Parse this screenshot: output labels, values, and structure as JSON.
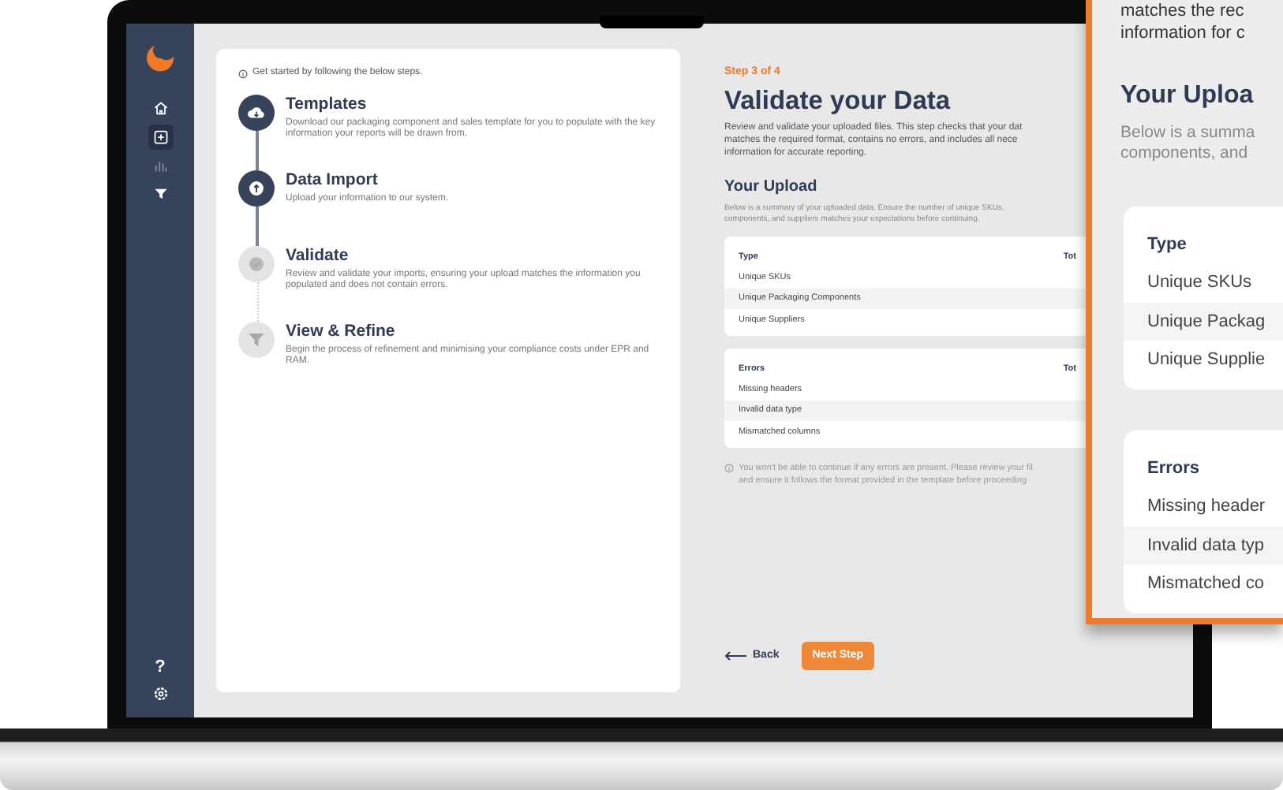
{
  "sidebar": {
    "items": [
      {
        "kind": "home",
        "selected": false,
        "disabled": false
      },
      {
        "kind": "import",
        "selected": true,
        "disabled": false
      },
      {
        "kind": "chart",
        "selected": false,
        "disabled": true
      },
      {
        "kind": "filter",
        "selected": false,
        "disabled": false
      }
    ],
    "help": "?"
  },
  "steps_panel": {
    "hint": "Get started by following the below steps.",
    "steps": [
      {
        "kind": "download",
        "title": "Templates",
        "description": "Download our packaging component and sales template for you to populate with the key information your reports will be drawn from.",
        "done": true
      },
      {
        "kind": "upload",
        "title": "Data Import",
        "description": "Upload your information to our system.",
        "done": true
      },
      {
        "kind": "check",
        "title": "Validate",
        "description": "Review and validate your imports, ensuring your upload matches the information you populated and does not contain errors.",
        "done": false
      },
      {
        "kind": "filter",
        "title": "View & Refine",
        "description": "Begin the process of refinement and minimising your compliance costs under EPR and RAM.",
        "done": false
      }
    ]
  },
  "validate": {
    "step_label": "Step 3 of 4",
    "title": "Validate your Data",
    "description": "Review and validate your uploaded files. This step checks that your dat\nmatches the required format, contains no errors, and includes all nece\ninformation for accurate reporting.",
    "upload_title": "Your Upload",
    "upload_description": "Below is a summary of your uploaded data. Ensure the number of unique SKUs,\ncomponents, and suppliers matches your expectations before continuing.",
    "tables": [
      {
        "columns": [
          "Type",
          "Tot"
        ],
        "rows": [
          "Unique SKUs",
          "Unique Packaging Components",
          "Unique Suppliers"
        ]
      },
      {
        "columns": [
          "Errors",
          "Tot"
        ],
        "rows": [
          "Missing headers",
          "Invalid data type",
          "Mismatched columns"
        ]
      }
    ],
    "note": "You won't be able to continue if any errors are present. Please review your fil\nand ensure it follows the format provided in the template before proceeding",
    "back": "Back",
    "next": "Next Step"
  },
  "zoom_panel": {
    "description": "matches the rec\ninformation for c",
    "upload_title": "Your Uploa",
    "upload_description": "Below is a summa\ncomponents, and",
    "tables": [
      {
        "header": "Type",
        "rows": [
          "Unique SKUs",
          "Unique Packag",
          "Unique Supplie"
        ]
      },
      {
        "header": "Errors",
        "rows": [
          "Missing header",
          "Invalid data typ",
          "Mismatched co"
        ]
      }
    ]
  }
}
